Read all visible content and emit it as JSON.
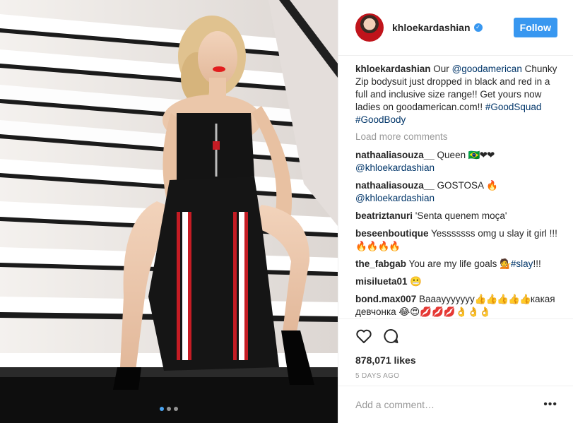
{
  "post": {
    "username": "khloekardashian",
    "verified_icon": "verified-badge-icon",
    "follow_label": "Follow",
    "caption": {
      "username": "khloekardashian",
      "text_1": " Our ",
      "mention": "@goodamerican",
      "text_2": " Chunky Zip bodysuit just dropped in black and red in a full and inclusive size range!! Get yours now ladies on goodamerican.com!! ",
      "hashtag_1": "#GoodSquad",
      "hashtag_2": "#GoodBody"
    },
    "load_more": "Load more comments",
    "comments": [
      {
        "user": "nathaaliasouza__",
        "text": " Queen ",
        "emoji": "🇧🇷❤❤",
        "mention": "@khloekardashian"
      },
      {
        "user": "nathaaliasouza__",
        "text": " GOSTOSA ",
        "emoji": "🔥",
        "mention": "@khloekardashian"
      },
      {
        "user": "beatriztanuri",
        "text": " 'Senta quenem moça'"
      },
      {
        "user": "beseenboutique",
        "text": " Yesssssss omg u slay it girl !!! ",
        "emoji": "🔥🔥🔥🔥"
      },
      {
        "user": "the_fabgab",
        "text": " You are my life goals ",
        "emoji": "💁",
        "hashtag": "#slay",
        "tail": "!!!"
      },
      {
        "user": "misilueta01",
        "text": " ",
        "emoji": "😬"
      },
      {
        "user": "bond.max007",
        "text": " Baaayyyyyyy",
        "emoji": "👍👍👍👍👍",
        "tail": "какая девчонка 😂😍💋💋💋👌👌👌"
      }
    ],
    "likes": "878,071 likes",
    "date": "5 DAYS AGO",
    "add_comment_placeholder": "Add a comment…",
    "more_options": "•••"
  },
  "icons": {
    "like": "heart-icon",
    "comment": "comment-bubble-icon"
  },
  "colors": {
    "accent": "#3897f0",
    "link": "#003569",
    "muted": "#999999"
  }
}
